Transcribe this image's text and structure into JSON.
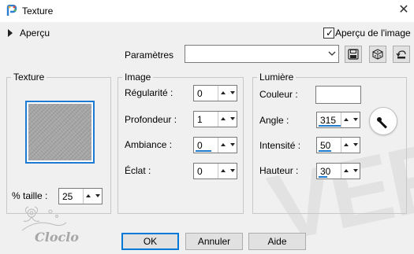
{
  "window": {
    "title": "Texture",
    "close_symbol": "✕"
  },
  "apercu": {
    "label": "Aperçu"
  },
  "preview_toggle": {
    "label": "Aperçu de l'image",
    "checked": true
  },
  "parametres": {
    "label": "Paramètres",
    "value": ""
  },
  "texture_group": {
    "title": "Texture",
    "size_label": "% taille :",
    "size_value": "25"
  },
  "image_group": {
    "title": "Image",
    "fields": [
      {
        "label": "Régularité :",
        "value": "0"
      },
      {
        "label": "Profondeur :",
        "value": "1"
      },
      {
        "label": "Ambiance :",
        "value": "0"
      },
      {
        "label": "Éclat :",
        "value": "0"
      }
    ]
  },
  "light_group": {
    "title": "Lumière",
    "color_label": "Couleur :",
    "color_value": "#ffffff",
    "fields": [
      {
        "label": "Angle :",
        "value": "315",
        "fill": 0.875
      },
      {
        "label": "Intensité :",
        "value": "50",
        "fill": 0.5
      },
      {
        "label": "Hauteur :",
        "value": "30",
        "fill": 0.33
      }
    ]
  },
  "buttons": {
    "ok": "OK",
    "cancel": "Annuler",
    "help": "Aide"
  },
  "watermark": "VERS",
  "logo": {
    "text": "Cloclo"
  },
  "colors": {
    "accent": "#1e7ad0",
    "window_bg": "#f0f0f0"
  }
}
